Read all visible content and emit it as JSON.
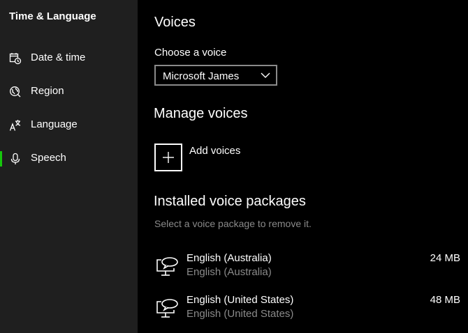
{
  "sidebar": {
    "title": "Time & Language",
    "items": [
      {
        "label": "Date & time",
        "icon": "clock-calendar-icon"
      },
      {
        "label": "Region",
        "icon": "globe-icon"
      },
      {
        "label": "Language",
        "icon": "language-icon"
      },
      {
        "label": "Speech",
        "icon": "microphone-icon",
        "active": true
      }
    ],
    "accent": "#16c60c"
  },
  "main": {
    "voices_heading": "Voices",
    "choose_label": "Choose a voice",
    "selected_voice": "Microsoft James",
    "manage_heading": "Manage voices",
    "add_voices_label": "Add voices",
    "installed_heading": "Installed voice packages",
    "installed_hint": "Select a voice package to remove it.",
    "packages": [
      {
        "name": "English (Australia)",
        "language": "English (Australia)",
        "size": "24 MB",
        "icon": "speech-bubble-monitor-icon"
      },
      {
        "name": "English (United States)",
        "language": "English (United States)",
        "size": "48 MB",
        "icon": "speech-bubble-monitor-icon"
      }
    ]
  }
}
